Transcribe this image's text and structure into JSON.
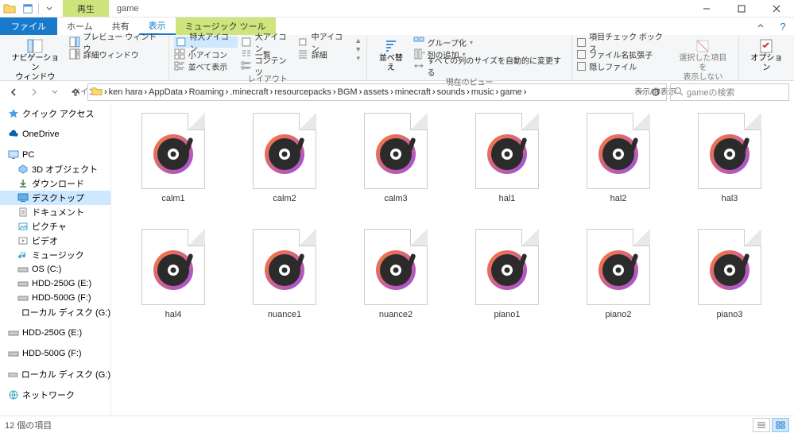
{
  "window": {
    "title": "game",
    "context_tool_label": "再生"
  },
  "ribbon_tabs": {
    "file": "ファイル",
    "home": "ホーム",
    "share": "共有",
    "view": "表示",
    "music_tools": "ミュージック ツール"
  },
  "ribbon": {
    "pane_group": "ペイン",
    "nav_pane": "ナビゲーション\nウィンドウ",
    "preview_pane": "プレビュー ウィンドウ",
    "details_pane": "詳細ウィンドウ",
    "layout_group": "レイアウト",
    "xlarge_icons": "特大アイコン",
    "large_icons": "大アイコン",
    "medium_icons": "中アイコン",
    "small_icons": "小アイコン",
    "list": "一覧",
    "details": "詳細",
    "tiles": "並べて表示",
    "content": "コンテンツ",
    "current_view_group": "現在のビュー",
    "sort": "並べ替え",
    "group_by": "グループ化",
    "add_columns": "列の追加",
    "size_all": "すべての列のサイズを自動的に変更する",
    "show_hide_group": "表示/非表示",
    "item_checkboxes": "項目チェック ボックス",
    "file_ext": "ファイル名拡張子",
    "hidden_items": "隠しファイル",
    "hide_selected": "選択した項目を\n表示しない",
    "options": "オプション"
  },
  "breadcrumbs": [
    "ken hara",
    "AppData",
    "Roaming",
    ".minecraft",
    "resourcepacks",
    "BGM",
    "assets",
    "minecraft",
    "sounds",
    "music",
    "game"
  ],
  "search": {
    "placeholder": "gameの検索"
  },
  "sidebar": {
    "quick_access": "クイック アクセス",
    "onedrive": "OneDrive",
    "pc": "PC",
    "objects3d": "3D オブジェクト",
    "downloads": "ダウンロード",
    "desktop": "デスクトップ",
    "documents": "ドキュメント",
    "pictures": "ピクチャ",
    "videos": "ビデオ",
    "music": "ミュージック",
    "os_c": "OS (C:)",
    "hdd250_e": "HDD-250G (E:)",
    "hdd500_f": "HDD-500G (F:)",
    "local_g": "ローカル ディスク (G:)",
    "hdd250_e2": "HDD-250G (E:)",
    "hdd500_f2": "HDD-500G (F:)",
    "local_g2": "ローカル ディスク (G:)",
    "network": "ネットワーク"
  },
  "files": [
    "calm1",
    "calm2",
    "calm3",
    "hal1",
    "hal2",
    "hal3",
    "hal4",
    "nuance1",
    "nuance2",
    "piano1",
    "piano2",
    "piano3"
  ],
  "status": {
    "item_count": "12 個の項目"
  },
  "colors": {
    "accent": "#1979ca",
    "context": "#cee57d"
  }
}
